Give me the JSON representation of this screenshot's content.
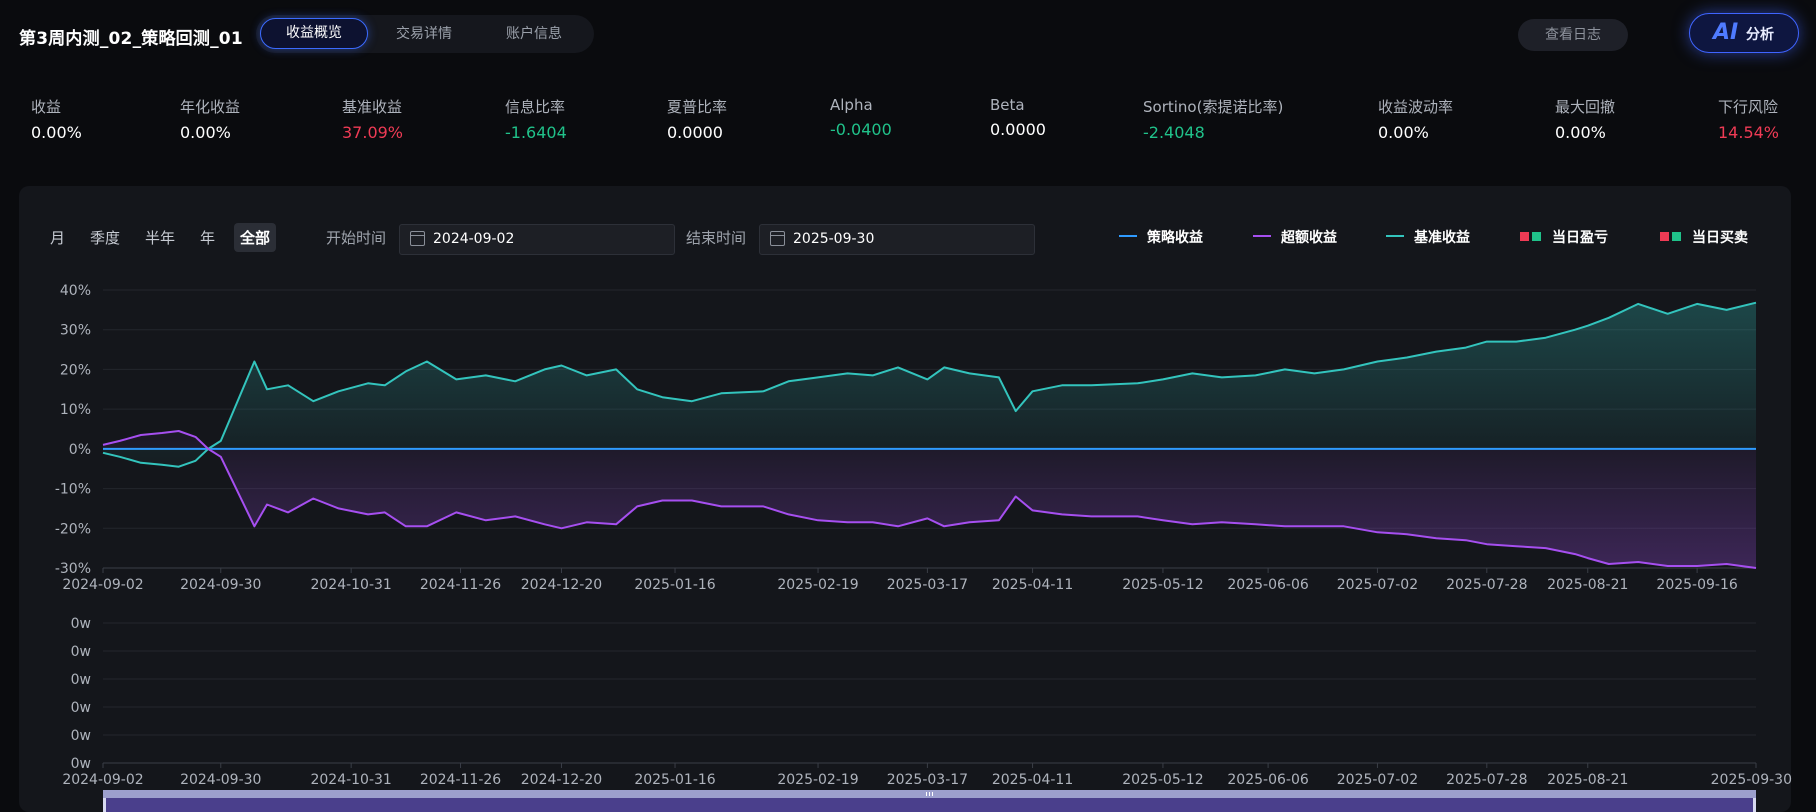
{
  "header": {
    "title": "第3周内测_02_策略回测_01",
    "tabs": [
      {
        "label": "收益概览",
        "active": true
      },
      {
        "label": "交易详情",
        "active": false
      },
      {
        "label": "账户信息",
        "active": false
      }
    ],
    "log_button": "查看日志",
    "ai_mark": "AI",
    "ai_label": "分析"
  },
  "metrics": [
    {
      "label": "收益",
      "value": "0.00%",
      "tone": "neutral"
    },
    {
      "label": "年化收益",
      "value": "0.00%",
      "tone": "neutral"
    },
    {
      "label": "基准收益",
      "value": "37.09%",
      "tone": "red"
    },
    {
      "label": "信息比率",
      "value": "-1.6404",
      "tone": "green"
    },
    {
      "label": "夏普比率",
      "value": "0.0000",
      "tone": "neutral"
    },
    {
      "label": "Alpha",
      "value": "-0.0400",
      "tone": "green"
    },
    {
      "label": "Beta",
      "value": "0.0000",
      "tone": "neutral"
    },
    {
      "label": "Sortino(索提诺比率)",
      "value": "-2.4048",
      "tone": "green"
    },
    {
      "label": "收益波动率",
      "value": "0.00%",
      "tone": "neutral"
    },
    {
      "label": "最大回撤",
      "value": "0.00%",
      "tone": "neutral"
    },
    {
      "label": "下行风险",
      "value": "14.54%",
      "tone": "red"
    }
  ],
  "controls": {
    "ranges": [
      "月",
      "季度",
      "半年",
      "年",
      "全部"
    ],
    "active_range": "全部",
    "start_label": "开始时间",
    "start_value": "2024-09-02",
    "end_label": "结束时间",
    "end_value": "2025-09-30"
  },
  "legend": [
    {
      "label": "策略收益",
      "color": "#2f9bff",
      "kind": "line"
    },
    {
      "label": "超额收益",
      "color": "#a64ff0",
      "kind": "line"
    },
    {
      "label": "基准收益",
      "color": "#33c4bd",
      "kind": "line"
    },
    {
      "label": "当日盈亏",
      "kind": "squares",
      "colors": [
        "#ef3b55",
        "#20c28a"
      ]
    },
    {
      "label": "当日买卖",
      "kind": "squares",
      "colors": [
        "#ef3b55",
        "#20c28a"
      ]
    }
  ],
  "chart_data": [
    {
      "type": "line",
      "title": "",
      "ylim": [
        -30,
        40
      ],
      "y_ticks": [
        "40%",
        "30%",
        "20%",
        "10%",
        "0%",
        "-10%",
        "-20%",
        "-30%"
      ],
      "x_ticks": [
        "2024-09-02",
        "2024-09-30",
        "2024-10-31",
        "2024-11-26",
        "2024-12-20",
        "2025-01-16",
        "2025-02-19",
        "2025-03-17",
        "2025-04-11",
        "2025-05-12",
        "2025-06-06",
        "2025-07-02",
        "2025-07-28",
        "2025-08-21",
        "2025-09-16"
      ],
      "grid": true,
      "legend_position": "top-right",
      "series": [
        {
          "name": "策略收益",
          "color": "#2f9bff",
          "x": [
            "2024-09-02",
            "2025-09-30"
          ],
          "values": [
            0,
            0
          ]
        },
        {
          "name": "基准收益",
          "color": "#33c4bd",
          "x": [
            "2024-09-02",
            "2024-09-06",
            "2024-09-11",
            "2024-09-16",
            "2024-09-20",
            "2024-09-24",
            "2024-09-27",
            "2024-09-30",
            "2024-10-08",
            "2024-10-11",
            "2024-10-16",
            "2024-10-22",
            "2024-10-28",
            "2024-11-04",
            "2024-11-08",
            "2024-11-13",
            "2024-11-18",
            "2024-11-25",
            "2024-12-02",
            "2024-12-09",
            "2024-12-16",
            "2024-12-20",
            "2024-12-26",
            "2025-01-02",
            "2025-01-07",
            "2025-01-13",
            "2025-01-20",
            "2025-01-27",
            "2025-02-06",
            "2025-02-12",
            "2025-02-19",
            "2025-02-26",
            "2025-03-04",
            "2025-03-10",
            "2025-03-17",
            "2025-03-21",
            "2025-03-27",
            "2025-04-03",
            "2025-04-07",
            "2025-04-11",
            "2025-04-18",
            "2025-04-25",
            "2025-05-06",
            "2025-05-12",
            "2025-05-19",
            "2025-05-26",
            "2025-06-03",
            "2025-06-10",
            "2025-06-17",
            "2025-06-24",
            "2025-07-02",
            "2025-07-09",
            "2025-07-16",
            "2025-07-23",
            "2025-07-28",
            "2025-08-04",
            "2025-08-11",
            "2025-08-18",
            "2025-08-21",
            "2025-08-26",
            "2025-09-02",
            "2025-09-09",
            "2025-09-16",
            "2025-09-23",
            "2025-09-30"
          ],
          "values": [
            -1,
            -2,
            -3.5,
            -4,
            -4.5,
            -3,
            0,
            2,
            22,
            15,
            16,
            12,
            14.5,
            16.5,
            16,
            19.5,
            22,
            17.5,
            18.5,
            17,
            20,
            21,
            18.5,
            20,
            15,
            13,
            12,
            14,
            14.5,
            17,
            18,
            19,
            18.5,
            20.5,
            17.5,
            20.5,
            19,
            18,
            9.5,
            14.5,
            16,
            16,
            16.5,
            17.5,
            19,
            18,
            18.5,
            20,
            19,
            20,
            22,
            23,
            24.5,
            25.5,
            27,
            27,
            28,
            30,
            31,
            33,
            36.5,
            34,
            36.5,
            35,
            36.8
          ]
        },
        {
          "name": "超额收益",
          "color": "#a64ff0",
          "x": [
            "2024-09-02",
            "2024-09-06",
            "2024-09-11",
            "2024-09-16",
            "2024-09-20",
            "2024-09-24",
            "2024-09-27",
            "2024-09-30",
            "2024-10-08",
            "2024-10-11",
            "2024-10-16",
            "2024-10-22",
            "2024-10-28",
            "2024-11-04",
            "2024-11-08",
            "2024-11-13",
            "2024-11-18",
            "2024-11-25",
            "2024-12-02",
            "2024-12-09",
            "2024-12-16",
            "2024-12-20",
            "2024-12-26",
            "2025-01-02",
            "2025-01-07",
            "2025-01-13",
            "2025-01-20",
            "2025-01-27",
            "2025-02-06",
            "2025-02-12",
            "2025-02-19",
            "2025-02-26",
            "2025-03-04",
            "2025-03-10",
            "2025-03-17",
            "2025-03-21",
            "2025-03-27",
            "2025-04-03",
            "2025-04-07",
            "2025-04-11",
            "2025-04-18",
            "2025-04-25",
            "2025-05-06",
            "2025-05-12",
            "2025-05-19",
            "2025-05-26",
            "2025-06-03",
            "2025-06-10",
            "2025-06-17",
            "2025-06-24",
            "2025-07-02",
            "2025-07-09",
            "2025-07-16",
            "2025-07-23",
            "2025-07-28",
            "2025-08-04",
            "2025-08-11",
            "2025-08-18",
            "2025-08-21",
            "2025-08-26",
            "2025-09-02",
            "2025-09-09",
            "2025-09-16",
            "2025-09-23",
            "2025-09-30"
          ],
          "values": [
            1,
            2,
            3.5,
            4,
            4.5,
            3,
            0,
            -2,
            -19.5,
            -14,
            -16,
            -12.5,
            -15,
            -16.5,
            -16,
            -19.5,
            -19.5,
            -16,
            -18,
            -17,
            -19,
            -20,
            -18.5,
            -19,
            -14.5,
            -13,
            -13,
            -14.5,
            -14.5,
            -16.5,
            -18,
            -18.5,
            -18.5,
            -19.5,
            -17.5,
            -19.5,
            -18.5,
            -18,
            -12,
            -15.5,
            -16.5,
            -17,
            -17,
            -18,
            -19,
            -18.5,
            -19,
            -19.5,
            -19.5,
            -19.5,
            -21,
            -21.5,
            -22.5,
            -23,
            -24,
            -24.5,
            -25,
            -26.5,
            -27.5,
            -29,
            -28.5,
            -29.5,
            -29.5,
            -29,
            -30
          ]
        }
      ]
    },
    {
      "type": "bar",
      "title": "",
      "y_ticks": [
        "0w",
        "0w",
        "0w",
        "0w",
        "0w",
        "0w"
      ],
      "x_ticks": [
        "2024-09-02",
        "2024-09-30",
        "2024-10-31",
        "2024-11-26",
        "2024-12-20",
        "2025-01-16",
        "2025-02-19",
        "2025-03-17",
        "2025-04-11",
        "2025-05-12",
        "2025-06-06",
        "2025-07-02",
        "2025-07-28",
        "2025-08-21",
        "2025-09-30"
      ],
      "grid": true,
      "series": [
        {
          "name": "当日盈亏",
          "values": []
        }
      ]
    }
  ],
  "slider": {
    "start": 0,
    "end": 1
  }
}
